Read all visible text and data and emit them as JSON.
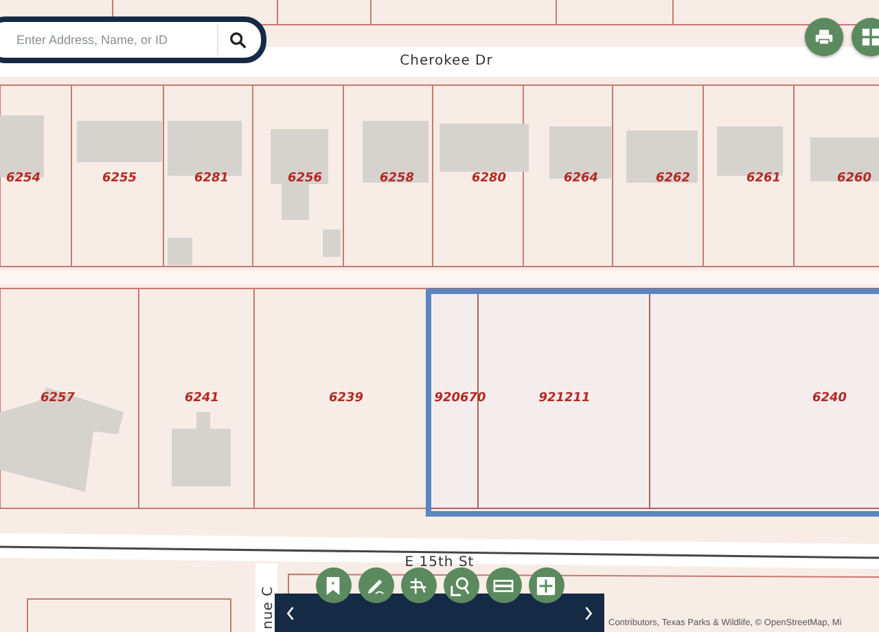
{
  "search": {
    "placeholder": "Enter Address, Name, or ID"
  },
  "map_buttons": [
    {
      "kind": "print"
    },
    {
      "kind": "grid"
    }
  ],
  "streets": [
    {
      "name": "Cherokee Dr"
    },
    {
      "name": "E 15th St"
    },
    {
      "name": "nue C"
    }
  ],
  "parcels_north": [
    {
      "label": "6254",
      "selected": false
    },
    {
      "label": "6255",
      "selected": false
    },
    {
      "label": "6281",
      "selected": false
    },
    {
      "label": "6256",
      "selected": false
    },
    {
      "label": "6258",
      "selected": false
    },
    {
      "label": "6280",
      "selected": false
    },
    {
      "label": "6264",
      "selected": false
    },
    {
      "label": "6262",
      "selected": false
    },
    {
      "label": "6261",
      "selected": false
    },
    {
      "label": "6260",
      "selected": false
    }
  ],
  "parcels_south": [
    {
      "label": "6257",
      "selected": false
    },
    {
      "label": "6241",
      "selected": false
    },
    {
      "label": "6239",
      "selected": false
    },
    {
      "label": "920670",
      "selected": true
    },
    {
      "label": "921211",
      "selected": true
    },
    {
      "label": "6240",
      "selected": true
    }
  ],
  "toolbar": {
    "buttons": [
      {
        "kind": "bookmark"
      },
      {
        "kind": "draw"
      },
      {
        "kind": "measure"
      },
      {
        "kind": "zoom-search"
      },
      {
        "kind": "layers"
      },
      {
        "kind": "add"
      }
    ]
  },
  "attribution": "Contributors, Texas Parks & Wildlife, © OpenStreetMap, Mi"
}
